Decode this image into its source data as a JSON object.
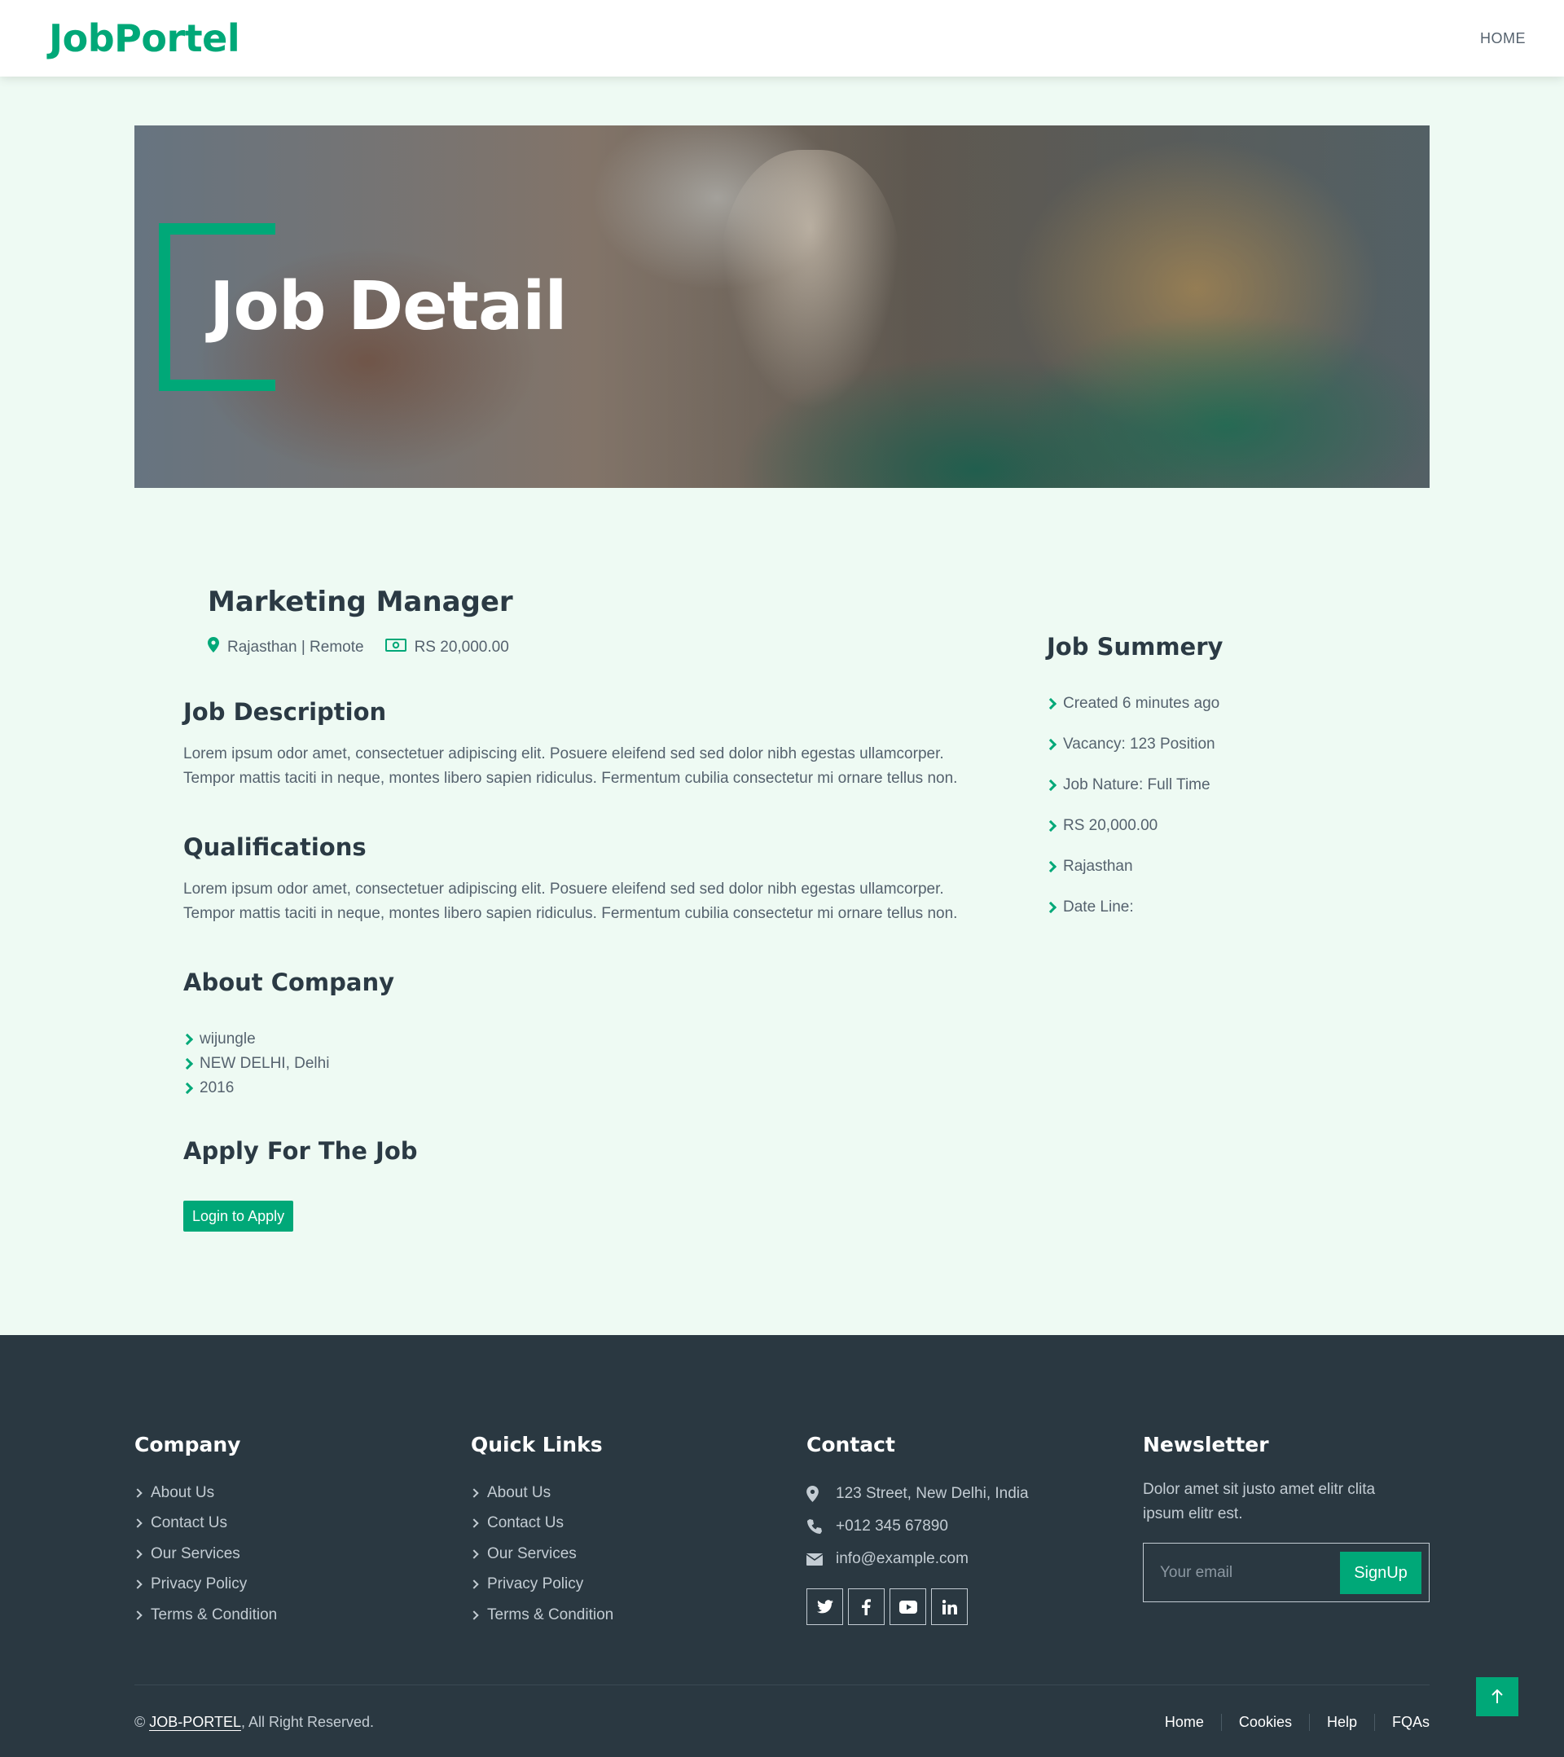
{
  "navbar": {
    "brand": "JobPortel",
    "links": [
      "HOME"
    ]
  },
  "hero": {
    "title": "Job Detail"
  },
  "job": {
    "title": "Marketing Manager",
    "location": "Rajasthan | Remote",
    "salary": "RS 20,000.00"
  },
  "description": {
    "heading": "Job Description",
    "text": "Lorem ipsum odor amet, consectetuer adipiscing elit. Posuere eleifend sed sed dolor nibh egestas ullamcorper. Tempor mattis taciti in neque, montes libero sapien ridiculus. Fermentum cubilia consectetur mi ornare tellus non."
  },
  "qualifications": {
    "heading": "Qualifications",
    "text": "Lorem ipsum odor amet, consectetuer adipiscing elit. Posuere eleifend sed sed dolor nibh egestas ullamcorper. Tempor mattis taciti in neque, montes libero sapien ridiculus. Fermentum cubilia consectetur mi ornare tellus non."
  },
  "company": {
    "heading": "About Company",
    "items": [
      "wijungle",
      "NEW DELHI, Delhi",
      "2016"
    ]
  },
  "apply": {
    "heading": "Apply For The Job",
    "button": "Login to Apply"
  },
  "summary": {
    "heading": "Job Summery",
    "items": [
      "Created 6 minutes ago",
      "Vacancy: 123 Position",
      "Job Nature: Full Time",
      "RS 20,000.00",
      "Rajasthan",
      "Date Line:"
    ]
  },
  "footer": {
    "company": {
      "heading": "Company",
      "links": [
        "About Us",
        "Contact Us",
        "Our Services",
        "Privacy Policy",
        "Terms & Condition"
      ]
    },
    "quick_links": {
      "heading": "Quick Links",
      "links": [
        "About Us",
        "Contact Us",
        "Our Services",
        "Privacy Policy",
        "Terms & Condition"
      ]
    },
    "contact": {
      "heading": "Contact",
      "address": "123 Street, New Delhi, India",
      "phone": "+012 345 67890",
      "email": "info@example.com",
      "social": [
        "twitter-icon",
        "facebook-icon",
        "youtube-icon",
        "linkedin-icon"
      ]
    },
    "newsletter": {
      "heading": "Newsletter",
      "text": "Dolor amet sit justo amet elitr clita ipsum elitr est.",
      "placeholder": "Your email",
      "button": "SignUp"
    },
    "copyright_prefix": "© ",
    "copyright_brand": "JOB-PORTEL",
    "copyright_suffix": ", All Right Reserved.",
    "bottom_links": [
      "Home",
      "Cookies",
      "Help",
      "FQAs"
    ]
  },
  "colors": {
    "accent": "#00a878",
    "page_bg": "#eefaf3",
    "footer_bg": "#2a3841",
    "heading": "#2b3a44"
  }
}
